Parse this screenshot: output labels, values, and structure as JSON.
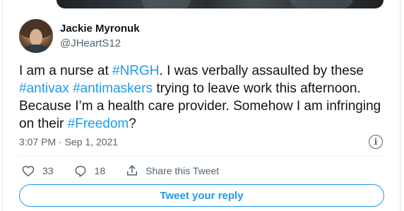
{
  "author": {
    "display_name": "Jackie Myronuk",
    "handle": "@JHeartS12"
  },
  "tweet": {
    "segments": [
      {
        "text": "I am a nurse at ",
        "hashtag": false
      },
      {
        "text": "#NRGH",
        "hashtag": true
      },
      {
        "text": ". I was verbally assaulted by these ",
        "hashtag": false
      },
      {
        "text": "#antivax",
        "hashtag": true
      },
      {
        "text": " ",
        "hashtag": false
      },
      {
        "text": "#antimaskers",
        "hashtag": true
      },
      {
        "text": " trying to leave work this afternoon. Because I’m a health care provider. Somehow I am infringing on their ",
        "hashtag": false
      },
      {
        "text": "#Freedom",
        "hashtag": true
      },
      {
        "text": "?",
        "hashtag": false
      }
    ],
    "timestamp": "3:07 PM · Sep 1, 2021"
  },
  "actions": {
    "like_count": "33",
    "reply_count": "18",
    "share_label": "Share this Tweet"
  },
  "reply_button_label": "Tweet your reply",
  "icons": {
    "info": "info-icon",
    "like": "heart-icon",
    "reply": "reply-bubble-icon",
    "share": "share-icon"
  },
  "colors": {
    "accent": "#1d9bf0",
    "text_primary": "#0f1419",
    "text_secondary": "#536471"
  }
}
